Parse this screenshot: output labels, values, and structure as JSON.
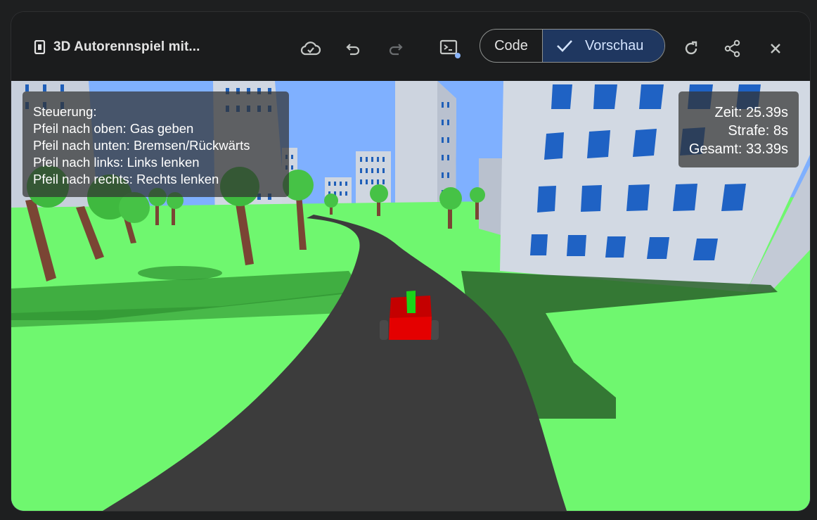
{
  "header": {
    "title": "3D Autorennspiel mit...",
    "icons": {
      "app": "app-frame-icon",
      "cloud": "cloud-check-icon",
      "undo": "undo-icon",
      "redo": "redo-icon",
      "console": "console-icon",
      "refresh": "refresh-icon",
      "share": "share-icon",
      "close": "close-icon"
    },
    "toggle": {
      "code_label": "Code",
      "preview_label": "Vorschau",
      "selected": "Vorschau"
    },
    "console_badge_color": "#8ab4f8"
  },
  "game": {
    "controls": {
      "heading": "Steuerung:",
      "lines": [
        "Pfeil nach oben: Gas geben",
        "Pfeil nach unten: Bremsen/Rückwärts",
        "Pfeil nach links: Links lenken",
        "Pfeil nach rechts: Rechts lenken"
      ]
    },
    "stats": {
      "time": "Zeit: 25.39s",
      "penalty": "Strafe: 8s",
      "total": "Gesamt: 33.39s"
    },
    "colors": {
      "sky": "#7fb0ff",
      "grass": "#6ff76f",
      "road": "#3c3c3c",
      "car_body": "#e40000",
      "car_stripe": "#19d419",
      "building": "#c8d0de",
      "window": "#1a5fc0",
      "trunk": "#7a4534",
      "foliage": "#3fb93f"
    }
  }
}
